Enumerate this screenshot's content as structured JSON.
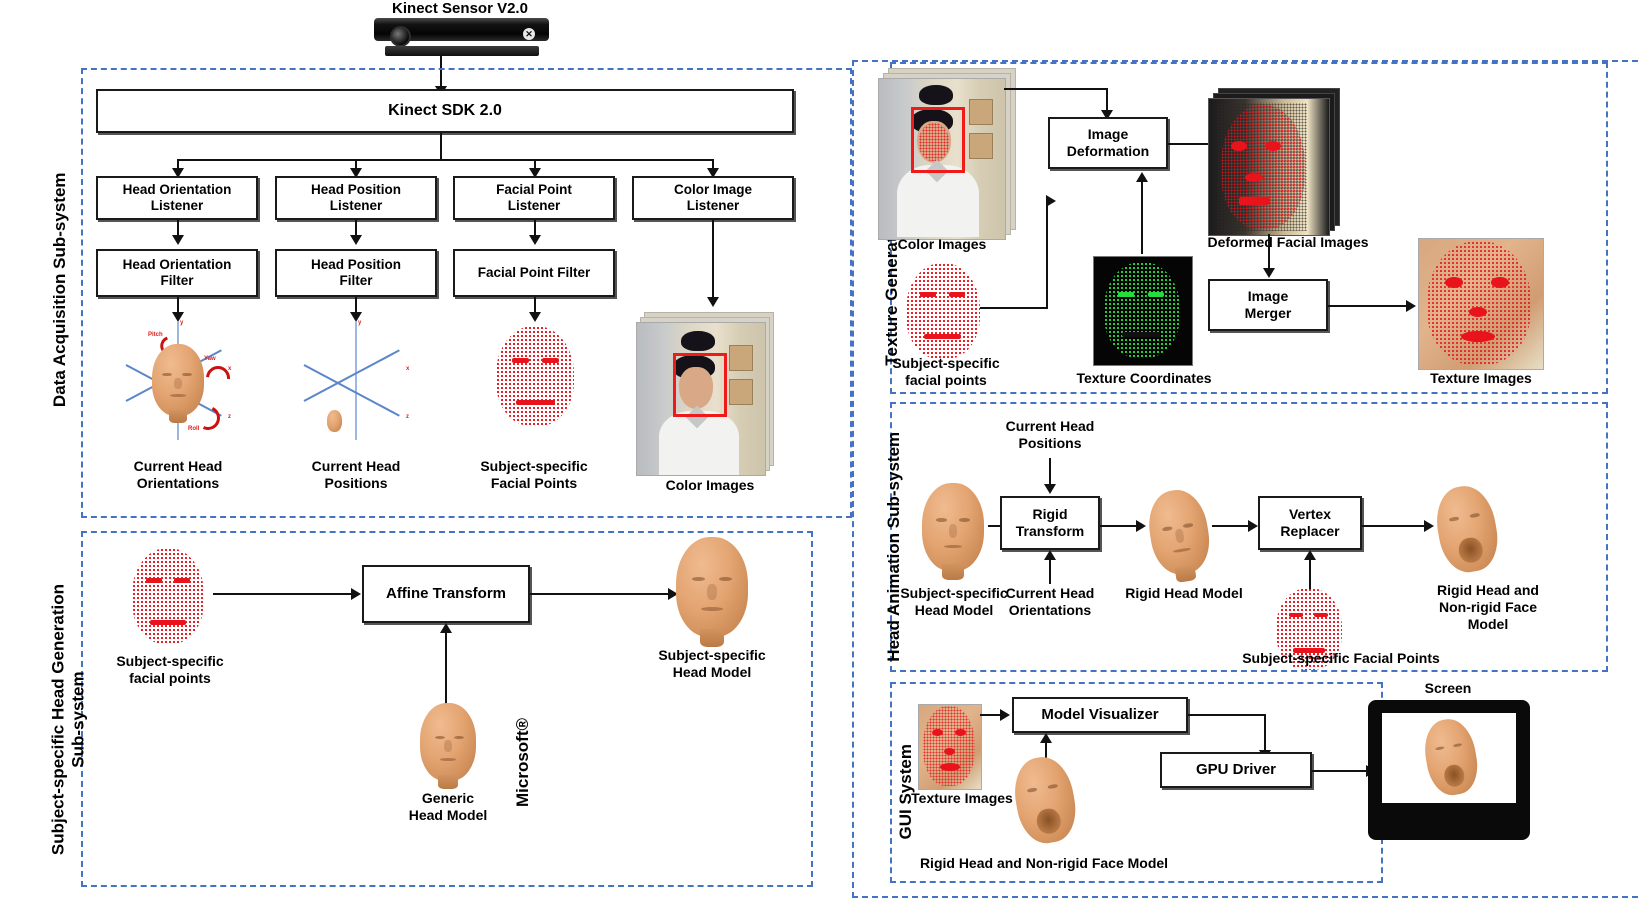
{
  "diagram": {
    "source_label": "Kinect Sensor V2.0",
    "sdk_label": "Kinect SDK 2.0"
  },
  "subsystems": {
    "data_acquisition": {
      "label": "Data Acquisition Sub-system",
      "listeners": [
        {
          "label": "Head Orientation\nListener",
          "line1": "Head Orientation",
          "line2": "Listener"
        },
        {
          "label": "Head Position\nListener",
          "line1": "Head Position",
          "line2": "Listener"
        },
        {
          "label": "Facial Point\nListener",
          "line1": "Facial Point",
          "line2": "Listener"
        },
        {
          "label": "Color Image\nListener",
          "line1": "Color Image",
          "line2": "Listener"
        }
      ],
      "filters": [
        {
          "line1": "Head Orientation",
          "line2": "Filter"
        },
        {
          "line1": "Head Position",
          "line2": "Filter"
        },
        {
          "line1": "Facial Point Filter",
          "line2": ""
        }
      ],
      "outputs": [
        {
          "line1": "Current Head",
          "line2": "Orientations"
        },
        {
          "line1": "Current Head",
          "line2": "Positions"
        },
        {
          "line1": "Subject-specific",
          "line2": "Facial Points"
        },
        {
          "line1": "Color Images",
          "line2": ""
        }
      ],
      "axis_ticks": {
        "x": "x",
        "y": "y",
        "z": "z",
        "pitch": "Pitch",
        "yaw": "Yaw",
        "roll": "Roll"
      }
    },
    "head_generation": {
      "label": "Subject-specific Head Generation\nSub-system",
      "label_line1": "Subject-specific Head Generation",
      "label_line2": "Sub-system",
      "process": "Affine Transform",
      "input_caption": {
        "line1": "Subject-specific",
        "line2": "facial points"
      },
      "generic_caption": {
        "line1": "Generic",
        "line2": "Head Model"
      },
      "brand": "Microsoft®",
      "output_caption": {
        "line1": "Subject-specific",
        "line2": "Head Model"
      }
    },
    "texture_generation": {
      "label": "Texture Generation Sub-system",
      "process_1": {
        "line1": "Image",
        "line2": "Deformation"
      },
      "process_2": {
        "line1": "Image",
        "line2": "Merger"
      },
      "caption_color_images": "Color Images",
      "caption_facial_points": {
        "line1": "Subject-specific",
        "line2": "facial points"
      },
      "caption_texture_coords": "Texture Coordinates",
      "caption_deformed": "Deformed Facial Images",
      "caption_texture_images": "Texture Images"
    },
    "head_animation": {
      "label": "Head Animation Sub-system",
      "process_1": {
        "line1": "Rigid",
        "line2": "Transform"
      },
      "process_2": {
        "line1": "Vertex",
        "line2": "Replacer"
      },
      "input_top": {
        "line1": "Current Head",
        "line2": "Positions"
      },
      "input_bottom": {
        "line1": "Current Head",
        "line2": "Orientations"
      },
      "caption_input_model": {
        "line1": "Subject-specific",
        "line2": "Head Model"
      },
      "caption_rigid_model": "Rigid Head Model",
      "caption_facial_points": "Subject-specific Facial Points",
      "caption_output": {
        "line1": "Rigid Head and",
        "line2": "Non-rigid Face",
        "line3": "Model"
      }
    },
    "gui_system": {
      "label": "GUI System",
      "process_1": "Model Visualizer",
      "process_2": "GPU Driver",
      "caption_texture": "Texture Images",
      "caption_model": "Rigid Head and Non-rigid Face Model",
      "caption_screen": "Screen"
    }
  },
  "colors": {
    "panel_border": "#4472C4",
    "box_border": "#1a1a1a",
    "connector": "#111111",
    "mesh_red": "#E8131B",
    "mesh_green": "#22DD3A",
    "skin": "#E3A471",
    "highlight_box": "#EF1B1B"
  }
}
